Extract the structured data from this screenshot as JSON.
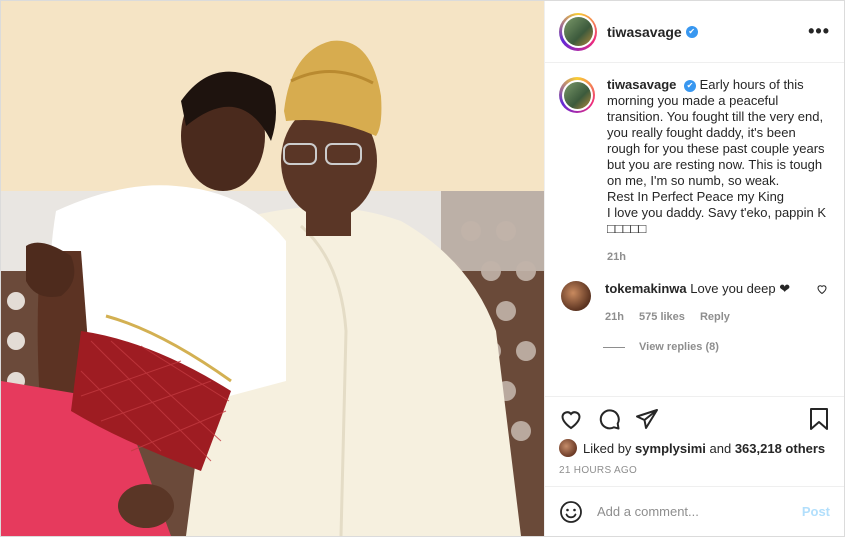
{
  "header": {
    "username": "tiwasavage",
    "verified_badge": "✔",
    "more_label": "•••"
  },
  "caption": {
    "username": "tiwasavage",
    "lines": [
      "Early hours of this",
      "morning you made a peaceful",
      "transition. You fought till the very end,",
      "you really fought daddy, it's been",
      "rough for you these past couple years",
      "but you are resting now. This is tough",
      "on me, I'm so numb, so weak.",
      "Rest In Perfect Peace my King",
      "I love you daddy. Savy t'eko, pappin K",
      "□□□□□"
    ],
    "time": "21h"
  },
  "comment": {
    "username": "tokemakinwa",
    "text": "Love you deep",
    "text2": "❤",
    "time": "21h",
    "likes": "575 likes",
    "reply_label": "Reply",
    "view_replies": "View replies (8)"
  },
  "likes": {
    "prefix": "Liked by",
    "user": "symplysimi",
    "and": "and",
    "others": "363,218 others"
  },
  "timestamp": "21 HOURS AGO",
  "add_comment": {
    "placeholder": "Add a comment...",
    "post_label": "Post"
  },
  "icons": {
    "like": "heart-icon",
    "comment": "comment-icon",
    "share": "share-icon",
    "save": "bookmark-icon",
    "emoji": "emoji-icon"
  },
  "colors": {
    "verified": "#3897f0",
    "post_button": "#b2dffc",
    "muted": "#8e8e8e"
  }
}
